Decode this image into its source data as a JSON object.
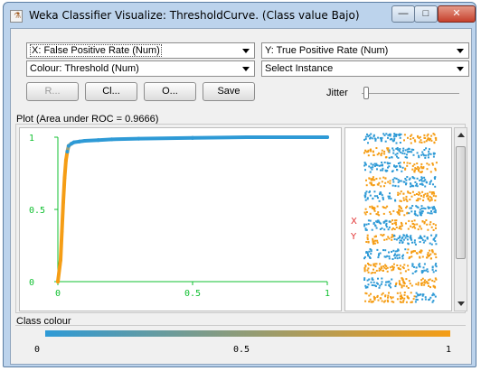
{
  "window": {
    "title": "Weka Classifier Visualize: ThresholdCurve. (Class value Bajo)",
    "minimize_label": "—",
    "maximize_label": "□",
    "close_label": "✕"
  },
  "controls": {
    "x_axis": "X: False Positive Rate (Num)",
    "y_axis": "Y: True Positive Rate (Num)",
    "colour": "Colour: Threshold (Num)",
    "select_instance": "Select Instance",
    "reset_label": "R...",
    "clear_label": "Cl...",
    "open_label": "O...",
    "save_label": "Save",
    "jitter_label": "Jitter",
    "jitter_value": 0
  },
  "plot": {
    "label": "Plot (Area under ROC = 0.9666)",
    "side_letters": [
      "X",
      "Y"
    ]
  },
  "chart_data": {
    "type": "line",
    "x": [
      0,
      0.01,
      0.015,
      0.02,
      0.025,
      0.03,
      0.035,
      0.04,
      0.05,
      0.06,
      0.08,
      0.1,
      0.15,
      0.2,
      0.3,
      0.5,
      0.7,
      1.0
    ],
    "y": [
      0,
      0.15,
      0.35,
      0.55,
      0.72,
      0.84,
      0.9,
      0.94,
      0.955,
      0.965,
      0.97,
      0.975,
      0.98,
      0.985,
      0.99,
      0.995,
      1.0,
      1.0
    ],
    "threshold_colour": "orange at low FPR end, blue along top of curve",
    "xlim": [
      0,
      1
    ],
    "ylim": [
      0,
      1
    ],
    "x_ticks": [
      "0",
      "0.5",
      "1"
    ],
    "y_ticks": [
      "0",
      "0.5",
      "1"
    ],
    "xlabel": "False Positive Rate",
    "ylabel": "True Positive Rate",
    "grid": false
  },
  "colour_bar": {
    "label": "Class colour",
    "ticks": [
      "0",
      "0.5",
      "1"
    ],
    "low_color": "#2e9ad6",
    "high_color": "#f59d15"
  }
}
